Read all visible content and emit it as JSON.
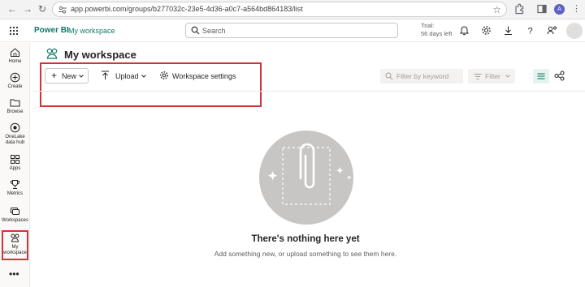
{
  "browser": {
    "url": "app.powerbi.com/groups/b277032c-23e5-4d36-a0c7-a564bd864183/list",
    "profile_initial": "A"
  },
  "header": {
    "brand": "Power BI",
    "breadcrumb": "My workspace",
    "search_placeholder": "Search",
    "trial_label": "Trial:",
    "trial_days": "56 days left"
  },
  "rail": {
    "items": [
      {
        "label": "Home",
        "icon": "home-icon"
      },
      {
        "label": "Create",
        "icon": "create-icon"
      },
      {
        "label": "Browse",
        "icon": "folder-icon"
      },
      {
        "label": "OneLake data hub",
        "icon": "onelake-icon"
      },
      {
        "label": "Apps",
        "icon": "apps-icon"
      },
      {
        "label": "Metrics",
        "icon": "trophy-icon"
      },
      {
        "label": "Workspaces",
        "icon": "workspaces-icon"
      },
      {
        "label": "My workspace",
        "icon": "my-workspace-icon"
      }
    ]
  },
  "workspace": {
    "title": "My workspace",
    "new_label": "New",
    "upload_label": "Upload",
    "settings_label": "Workspace settings",
    "filter_placeholder": "Filter by keyword",
    "filter_label": "Filter"
  },
  "empty_state": {
    "title": "There's nothing here yet",
    "subtitle": "Add something new, or upload something to see them here."
  },
  "colors": {
    "brand_teal": "#117865",
    "highlight_red": "#d13438",
    "illustration_gray": "#c8c6c4"
  }
}
